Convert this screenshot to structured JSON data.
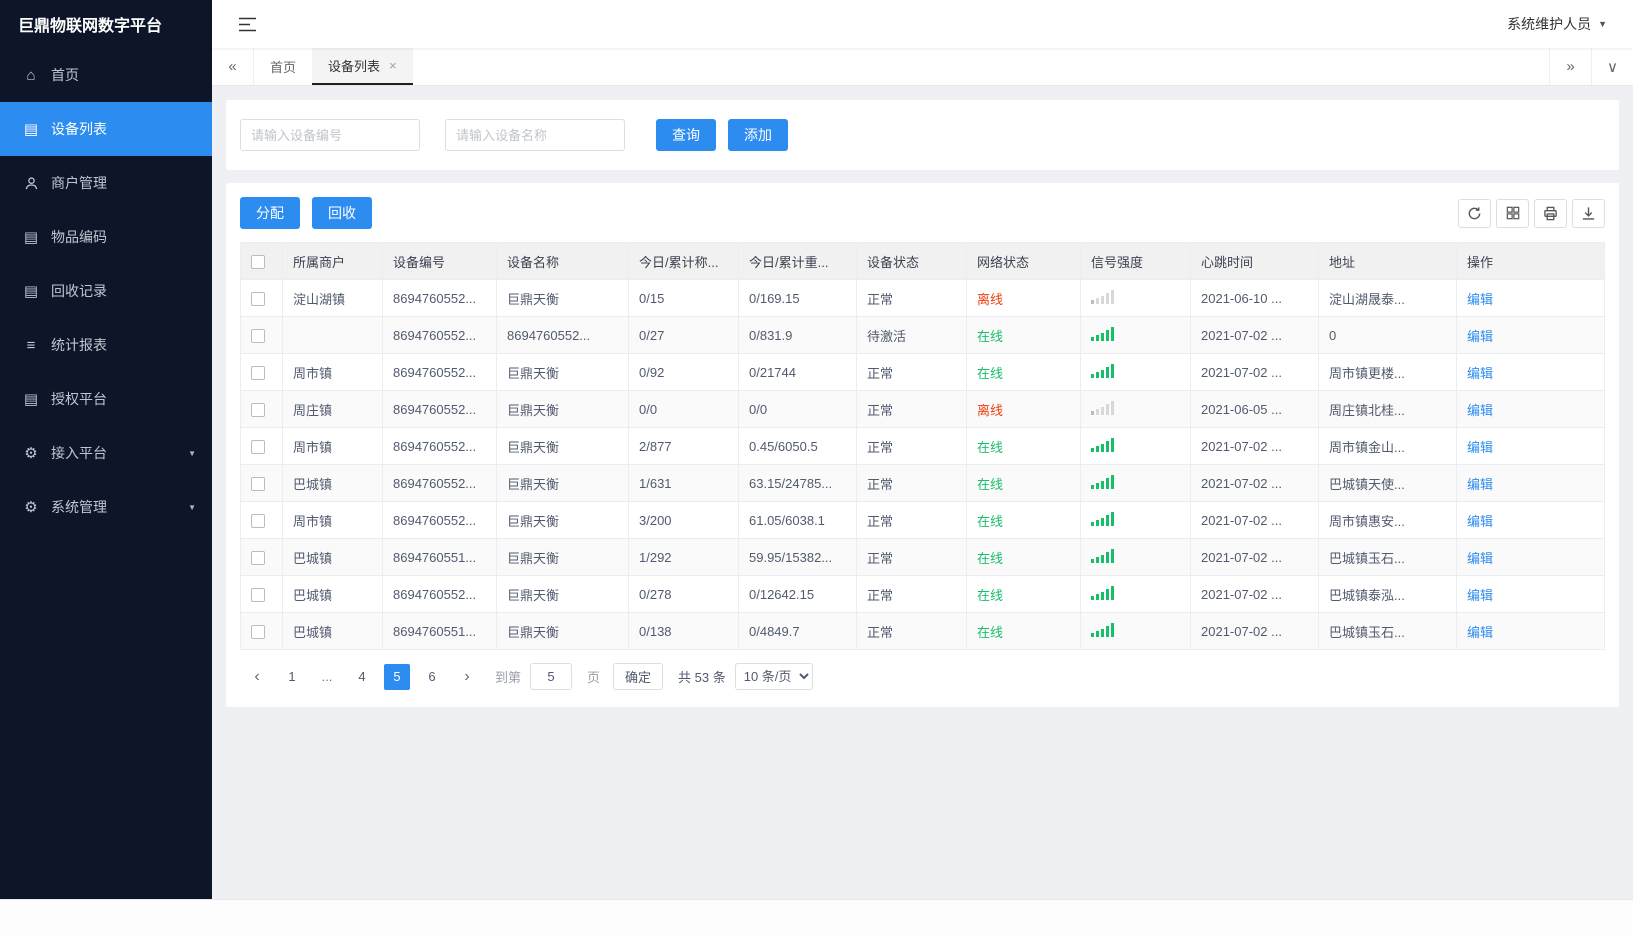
{
  "colors": {
    "primary": "#2d8cf0",
    "success": "#19be6b",
    "danger": "#ed4014",
    "sidebar_bg": "#0c1628"
  },
  "app": {
    "title": "巨鼎物联网数字平台",
    "user_menu": "系统维护人员"
  },
  "icons": {
    "home": "⌂",
    "doc": "▤",
    "list": "≡",
    "gear": "⚙",
    "double_left": "«",
    "double_right": "»",
    "chevron_down": "∨",
    "caret_down": "▼",
    "close": "×",
    "prev": "‹",
    "next": "›"
  },
  "sidebar": {
    "items": [
      {
        "label": "首页"
      },
      {
        "label": "设备列表"
      },
      {
        "label": "商户管理"
      },
      {
        "label": "物品编码"
      },
      {
        "label": "回收记录"
      },
      {
        "label": "统计报表"
      },
      {
        "label": "授权平台"
      },
      {
        "label": "接入平台"
      },
      {
        "label": "系统管理"
      }
    ]
  },
  "tabs": {
    "home": "首页",
    "devices": "设备列表"
  },
  "search": {
    "device_no_placeholder": "请输入设备编号",
    "device_name_placeholder": "请输入设备名称",
    "query_label": "查询",
    "add_label": "添加"
  },
  "actions": {
    "allocate_label": "分配",
    "recycle_label": "回收"
  },
  "table": {
    "columns": [
      "所属商户",
      "设备编号",
      "设备名称",
      "今日/累计称...",
      "今日/累计重...",
      "设备状态",
      "网络状态",
      "信号强度",
      "心跳时间",
      "地址",
      "操作"
    ],
    "edit_label": "编辑",
    "rows": [
      {
        "merchant": "淀山湖镇",
        "device_no": "8694760552...",
        "device_name": "巨鼎天衡",
        "count": "0/15",
        "weight": "0/169.15",
        "status": "正常",
        "network": "离线",
        "network_state": "offline",
        "signal": "weak",
        "heartbeat": "2021-06-10 ...",
        "address": "淀山湖晟泰..."
      },
      {
        "merchant": "",
        "device_no": "8694760552...",
        "device_name": "8694760552...",
        "count": "0/27",
        "weight": "0/831.9",
        "status": "待激活",
        "network": "在线",
        "network_state": "online",
        "signal": "strong",
        "heartbeat": "2021-07-02 ...",
        "address": "0"
      },
      {
        "merchant": "周市镇",
        "device_no": "8694760552...",
        "device_name": "巨鼎天衡",
        "count": "0/92",
        "weight": "0/21744",
        "status": "正常",
        "network": "在线",
        "network_state": "online",
        "signal": "strong",
        "heartbeat": "2021-07-02 ...",
        "address": "周市镇更楼..."
      },
      {
        "merchant": "周庄镇",
        "device_no": "8694760552...",
        "device_name": "巨鼎天衡",
        "count": "0/0",
        "weight": "0/0",
        "status": "正常",
        "network": "离线",
        "network_state": "offline",
        "signal": "weak",
        "heartbeat": "2021-06-05 ...",
        "address": "周庄镇北桂..."
      },
      {
        "merchant": "周市镇",
        "device_no": "8694760552...",
        "device_name": "巨鼎天衡",
        "count": "2/877",
        "weight": "0.45/6050.5",
        "status": "正常",
        "network": "在线",
        "network_state": "online",
        "signal": "strong",
        "heartbeat": "2021-07-02 ...",
        "address": "周市镇金山..."
      },
      {
        "merchant": "巴城镇",
        "device_no": "8694760552...",
        "device_name": "巨鼎天衡",
        "count": "1/631",
        "weight": "63.15/24785...",
        "status": "正常",
        "network": "在线",
        "network_state": "online",
        "signal": "strong",
        "heartbeat": "2021-07-02 ...",
        "address": "巴城镇天使..."
      },
      {
        "merchant": "周市镇",
        "device_no": "8694760552...",
        "device_name": "巨鼎天衡",
        "count": "3/200",
        "weight": "61.05/6038.1",
        "status": "正常",
        "network": "在线",
        "network_state": "online",
        "signal": "strong",
        "heartbeat": "2021-07-02 ...",
        "address": "周市镇惠安..."
      },
      {
        "merchant": "巴城镇",
        "device_no": "8694760551...",
        "device_name": "巨鼎天衡",
        "count": "1/292",
        "weight": "59.95/15382...",
        "status": "正常",
        "network": "在线",
        "network_state": "online",
        "signal": "strong",
        "heartbeat": "2021-07-02 ...",
        "address": "巴城镇玉石..."
      },
      {
        "merchant": "巴城镇",
        "device_no": "8694760552...",
        "device_name": "巨鼎天衡",
        "count": "0/278",
        "weight": "0/12642.15",
        "status": "正常",
        "network": "在线",
        "network_state": "online",
        "signal": "strong",
        "heartbeat": "2021-07-02 ...",
        "address": "巴城镇泰泓..."
      },
      {
        "merchant": "巴城镇",
        "device_no": "8694760551...",
        "device_name": "巨鼎天衡",
        "count": "0/138",
        "weight": "0/4849.7",
        "status": "正常",
        "network": "在线",
        "network_state": "online",
        "signal": "strong",
        "heartbeat": "2021-07-02 ...",
        "address": "巴城镇玉石..."
      }
    ]
  },
  "pagination": {
    "pages": [
      "1",
      "...",
      "4",
      "5",
      "6"
    ],
    "active_page": "5",
    "goto_label": "到第",
    "goto_value": "5",
    "page_unit": "页",
    "confirm_label": "确定",
    "total_label": "共 53 条",
    "per_page": "10 条/页"
  }
}
